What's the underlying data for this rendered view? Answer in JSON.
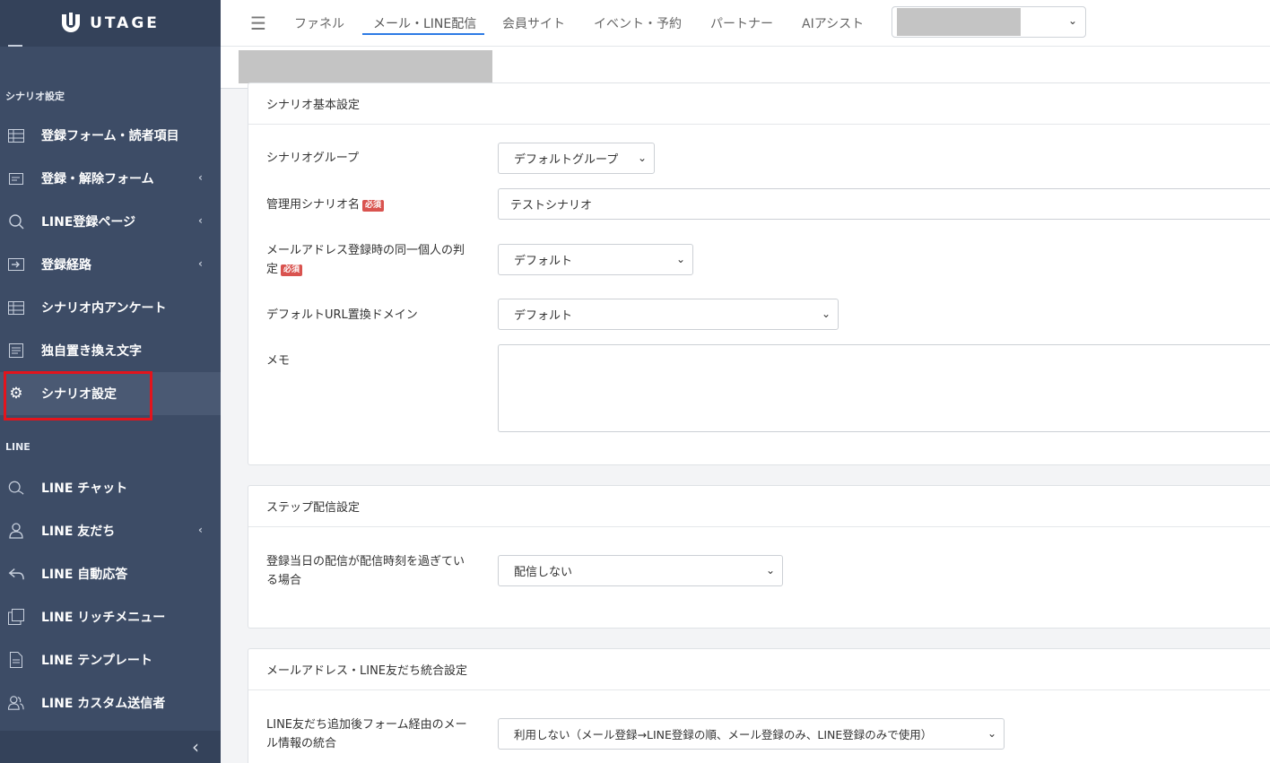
{
  "brand": {
    "name": "UTAGE"
  },
  "sidebar": {
    "section_scenario": "シナリオ設定",
    "section_line": "LINE",
    "items": [
      {
        "label": "登録フォーム・読者項目",
        "icon": "table-icon",
        "chevron": false
      },
      {
        "label": "登録・解除フォーム",
        "icon": "form-icon",
        "chevron": true
      },
      {
        "label": "LINE登録ページ",
        "icon": "search-icon",
        "chevron": true
      },
      {
        "label": "登録経路",
        "icon": "login-icon",
        "chevron": true
      },
      {
        "label": "シナリオ内アンケート",
        "icon": "table-icon",
        "chevron": false
      },
      {
        "label": "独自置き換え文字",
        "icon": "document-icon",
        "chevron": false
      },
      {
        "label": "シナリオ設定",
        "icon": "gear-icon",
        "chevron": false,
        "active": true
      },
      {
        "label": "LINE チャット",
        "icon": "chat-icon",
        "chevron": false
      },
      {
        "label": "LINE 友だち",
        "icon": "user-icon",
        "chevron": true
      },
      {
        "label": "LINE 自動応答",
        "icon": "reply-icon",
        "chevron": false
      },
      {
        "label": "LINE リッチメニュー",
        "icon": "copy-icon",
        "chevron": false
      },
      {
        "label": "LINE テンプレート",
        "icon": "file-icon",
        "chevron": false
      },
      {
        "label": "LINE カスタム送信者",
        "icon": "users-icon",
        "chevron": false
      }
    ]
  },
  "topnav": {
    "tabs": [
      "ファネル",
      "メール・LINE配信",
      "会員サイト",
      "イベント・予約",
      "パートナー",
      "AIアシスト"
    ],
    "active_tab": "メール・LINE配信"
  },
  "basic": {
    "header": "シナリオ基本設定",
    "group_label": "シナリオグループ",
    "group_value": "デフォルトグループ",
    "name_label": "管理用シナリオ名",
    "name_value": "テストシナリオ",
    "required": "必須",
    "identity_label_1": "メールアドレス登録時の同一個人の判",
    "identity_label_2": "定",
    "identity_value": "デフォルト",
    "domain_label": "デフォルトURL置換ドメイン",
    "domain_value": "デフォルト",
    "memo_label": "メモ"
  },
  "step": {
    "header": "ステップ配信設定",
    "label_1": "登録当日の配信が配信時刻を過ぎてい",
    "label_2": "る場合",
    "value": "配信しない"
  },
  "merge": {
    "header": "メールアドレス・LINE友だち統合設定",
    "label_1": "LINE友だち追加後フォーム経由のメー",
    "label_2": "ル情報の統合",
    "value": "利用しない（メール登録→LINE登録の順、メール登録のみ、LINE登録のみで使用）"
  },
  "colors": {
    "sidebar": "#3d4c66",
    "accent": "#2d7be5",
    "required": "#d9534f",
    "highlight": "#e3141c"
  }
}
